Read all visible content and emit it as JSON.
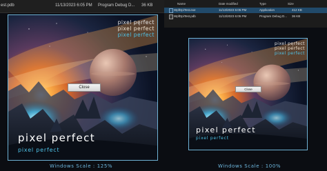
{
  "left_strip": {
    "name": "est.pdb",
    "date": "11/13/2023 6:05 PM",
    "type": "Program Debug D...",
    "size": "36 KB"
  },
  "right_explorer": {
    "headers": {
      "name": "Name",
      "date": "Date modified",
      "type": "Type",
      "size": "Size"
    },
    "rows": [
      {
        "name": "WpfDpiTest.exe",
        "date": "11/13/2023 6:05 PM",
        "type": "Application",
        "size": "412 KB",
        "selected": true
      },
      {
        "name": "WpfDpiTest.pdb",
        "date": "11/13/2023 6:05 PM",
        "type": "Program Debug D...",
        "size": "36 KB",
        "selected": false
      }
    ]
  },
  "app": {
    "corner_lines": [
      "pixel perfect",
      "pixel perfect",
      "pixel perfect"
    ],
    "title_big": "pixel perfect",
    "title_small": "pixel perfect",
    "close_label": "Close"
  },
  "scales": {
    "left": "Windows Scale : 125%",
    "right": "Windows Scale : 100%"
  },
  "colors": {
    "accent_cyan": "#4fc3e8",
    "window_border": "#6fb3d6",
    "selection": "#214a6a"
  }
}
